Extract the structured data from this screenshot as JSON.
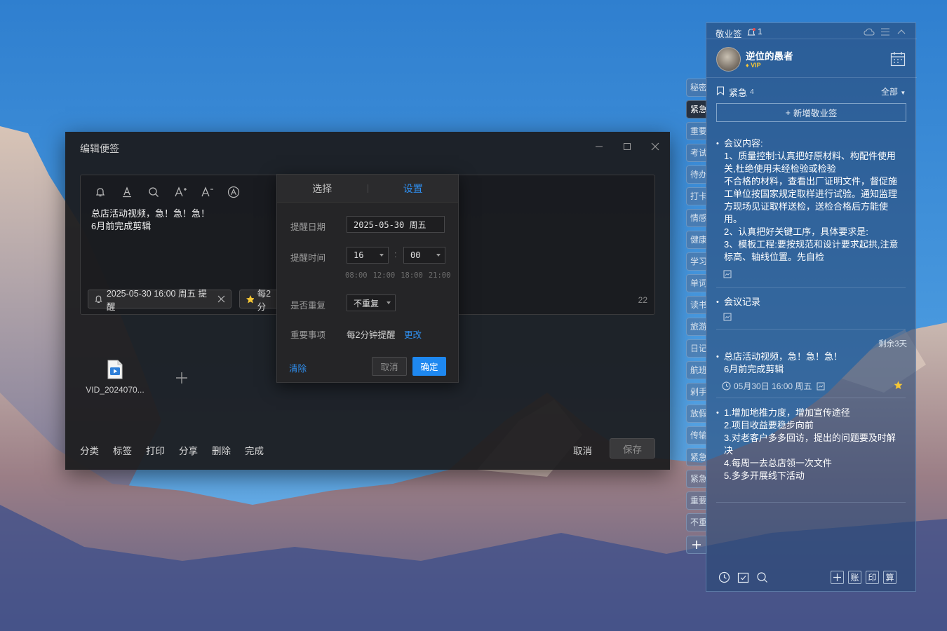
{
  "editor": {
    "title": "编辑便签",
    "note_lines": [
      "总店活动视频，急！急！急！",
      "6月前完成剪辑"
    ],
    "reminder_tag": "2025-05-30 16:00 周五 提醒",
    "important_tag": "每2分",
    "char_count": "22",
    "attachment_name": "VID_2024070...",
    "footer": {
      "category": "分类",
      "tag": "标签",
      "print": "打印",
      "share": "分享",
      "delete": "删除",
      "done": "完成",
      "cancel": "取消",
      "save": "保存"
    }
  },
  "reminder_popup": {
    "tabs": {
      "select": "选择",
      "settings": "设置"
    },
    "date_label": "提醒日期",
    "date_value": "2025-05-30  周五",
    "time_label": "提醒时间",
    "hour": "16",
    "minute": "00",
    "time_sep": ":",
    "quick_times": [
      "08:00",
      "12:00",
      "18:00",
      "21:00"
    ],
    "repeat_label": "是否重复",
    "repeat_value": "不重复",
    "important_label": "重要事项",
    "important_value": "每2分钟提醒",
    "change_link": "更改",
    "clear_link": "清除",
    "cancel": "取消",
    "confirm": "确定"
  },
  "side_tabs": [
    "秘密",
    "紧急",
    "重要",
    "考试",
    "待办",
    "打卡",
    "情感",
    "健康",
    "学习",
    "单词",
    "读书",
    "旅游",
    "日记",
    "航班",
    "剁手",
    "放假",
    "传输",
    "紧急",
    "紧急",
    "重要",
    "不重"
  ],
  "side_tab_active": 1,
  "panel": {
    "app_title": "敬业签",
    "bell_count": "1",
    "user_name": "逆位的愚者",
    "vip": "VIP",
    "category": "紧急",
    "category_count": "4",
    "filter": "全部",
    "add_button": "新增敬业签",
    "notes": [
      {
        "lines": [
          "会议内容:",
          "1、质量控制:认真把好原材料、构配件使用",
          "关,杜绝使用未经检验或检验",
          "不合格的材料，查看出厂证明文件，督促施",
          "工单位按国家规定取样进行试验。通知监理",
          "方现场见证取样送检，送检合格后方能使",
          "用。",
          "2、认真把好关键工序，具体要求是:",
          "3、模板工程:要按规范和设计要求起拱,注意",
          "标高、轴线位置。先自检"
        ]
      },
      {
        "lines": [
          "会议记录"
        ]
      },
      {
        "remain": "剩余3天",
        "lines": [
          "总店活动视频，急！急！急！",
          "6月前完成剪辑"
        ],
        "reminder": "05月30日 16:00 周五"
      },
      {
        "lines": [
          "1.增加地推力度，增加宣传途径",
          "2.项目收益要稳步向前",
          "3.对老客户多多回访，提出的问题要及时解",
          "决",
          "4.每周一去总店领一次文件",
          "5.多多开展线下活动"
        ]
      }
    ],
    "bottom_buttons": [
      "账",
      "印",
      "算"
    ]
  },
  "colors": {
    "accent": "#2f8ff0",
    "vip_gold": "#f6c735"
  }
}
